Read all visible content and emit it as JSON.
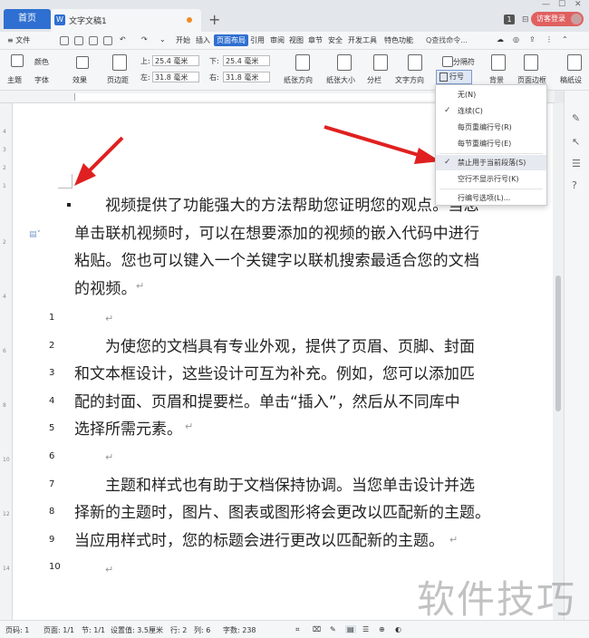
{
  "tabs": {
    "home": "首页",
    "doc_title": "文字文稿1",
    "new_tab": "+"
  },
  "topright": {
    "badge": "1",
    "visitor": "访客登录"
  },
  "menubar": {
    "file": "≡ 文件",
    "items": [
      "开始",
      "插入",
      "页面布局",
      "引用",
      "审阅",
      "视图",
      "章节",
      "安全",
      "开发工具",
      "特色功能"
    ],
    "active": "页面布局",
    "search": "Q查找命令..."
  },
  "ribbon": {
    "theme": "主题",
    "color": "颜色",
    "font": "字体",
    "effect": "效果",
    "margin": "页边距",
    "top_label": "上:",
    "top_value": "25.4 毫米",
    "bottom_label": "下:",
    "bottom_value": "25.4 毫米",
    "left_label": "左:",
    "left_value": "31.8 毫米",
    "right_label": "右:",
    "right_value": "31.8 毫米",
    "orientation": "纸张方向",
    "size": "纸张大小",
    "columns": "分栏",
    "text_direction": "文字方向",
    "line_numbers": "行号",
    "separator": "分隔符",
    "background": "背景",
    "page_border": "页面边框",
    "draft": "稿纸设"
  },
  "dropdown": {
    "items": [
      {
        "label": "无(N)",
        "checked": false
      },
      {
        "label": "连续(C)",
        "checked": true
      },
      {
        "label": "每页重编行号(R)",
        "checked": false
      },
      {
        "label": "每节重编行号(E)",
        "checked": false
      },
      {
        "label": "禁止用于当前段落(S)",
        "checked": true,
        "highlight": true
      },
      {
        "label": "空行不显示行号(K)",
        "checked": false
      },
      {
        "label": "行编号选项(L)...",
        "checked": false
      }
    ]
  },
  "document": {
    "para1": "视频提供了功能强大的方法帮助您证明您的观点。当您单击联机视频时，可以在想要添加的视频的嵌入代码中进行粘贴。您也可以键入一个关键字以联机搜索最适合您的文档的视频。",
    "lines": [
      {
        "num": "1",
        "text": ""
      },
      {
        "num": "2",
        "text": "为使您的文档具有专业外观，提供了页眉、页脚、封面"
      },
      {
        "num": "3",
        "text": "和文本框设计，这些设计可互为补充。例如，您可以添加匹"
      },
      {
        "num": "4",
        "text": "配的封面、页眉和提要栏。单击“插入”，然后从不同库中"
      },
      {
        "num": "5",
        "text": "选择所需元素。"
      },
      {
        "num": "6",
        "text": ""
      },
      {
        "num": "7",
        "text": "主题和样式也有助于文档保持协调。当您单击设计并选"
      },
      {
        "num": "8",
        "text": "择新的主题时，图片、图表或图形将会更改以匹配新的主题。"
      },
      {
        "num": "9",
        "text": "当应用样式时，您的标题会进行更改以匹配新的主题。"
      },
      {
        "num": "10",
        "text": ""
      }
    ]
  },
  "status": {
    "page_num": "页码: 1",
    "pages": "页面: 1/1",
    "section": "节: 1/1",
    "setting": "设置值: 3.5厘米",
    "row": "行: 2",
    "col": "列: 6",
    "words": "字数: 238"
  },
  "watermark": "软件技巧",
  "colors": {
    "accent": "#2f6fd1",
    "arrow": "#e02020",
    "visitor": "#e06060"
  }
}
